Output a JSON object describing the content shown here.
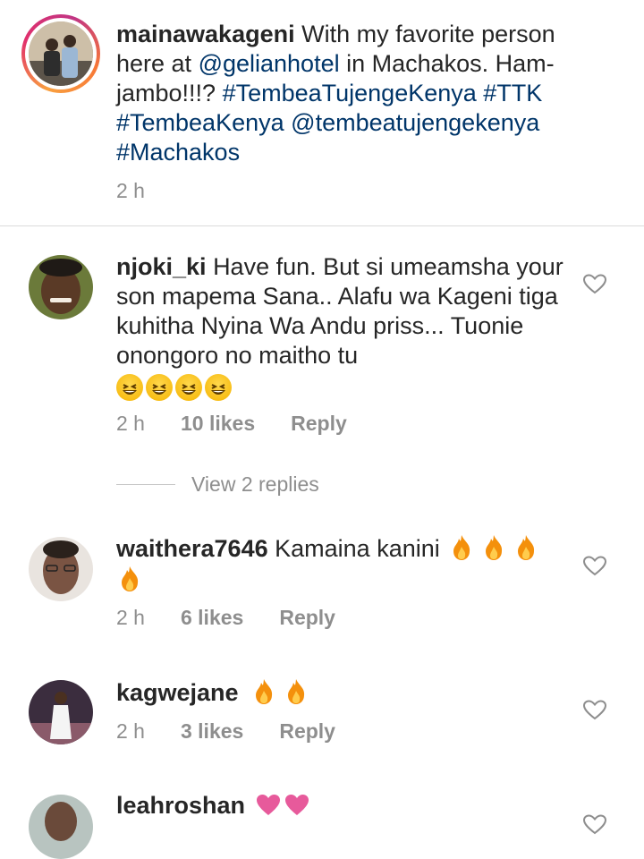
{
  "caption": {
    "username": "mainawakageni",
    "text_before": "With my favorite person here at ",
    "mention1": "@gelianhotel",
    "text_mid": " in Machakos. Ham-jambo!!!? ",
    "tags": "#TembeaTujengeKenya #TTK #TembeaKenya",
    "mention2": "@tembeatujengekenya",
    "tag_last": "#Machakos",
    "time": "2 h"
  },
  "comments": [
    {
      "username": "njoki_ki",
      "text": "Have fun. But si umeamsha your son mapema Sana.. Alafu wa Kageni tiga kuhitha Nyina Wa Andu priss... Tuonie onongoro no maitho tu",
      "emoji": "grinning-squinting-face-emoji x4",
      "time": "2 h",
      "likes": "10 likes",
      "reply": "Reply",
      "view_replies": "View 2 replies"
    },
    {
      "username": "waithera7646",
      "text": "Kamaina kanini",
      "emoji": "fire-emoji x4",
      "time": "2 h",
      "likes": "6 likes",
      "reply": "Reply"
    },
    {
      "username": "kagwejane",
      "text": "",
      "emoji": "fire-emoji x2",
      "time": "2 h",
      "likes": "3 likes",
      "reply": "Reply"
    },
    {
      "username": "leahroshan",
      "text": "",
      "emoji": "pink-heart-emoji x2"
    }
  ],
  "colors": {
    "text": "#262626",
    "secondary": "#8e8e8e",
    "link": "#003569",
    "divider": "#dbdbdb"
  },
  "icons": [
    "like-heart-icon",
    "avatar",
    "fire-emoji",
    "grinning-squinting-face-emoji",
    "pink-heart-emoji"
  ]
}
